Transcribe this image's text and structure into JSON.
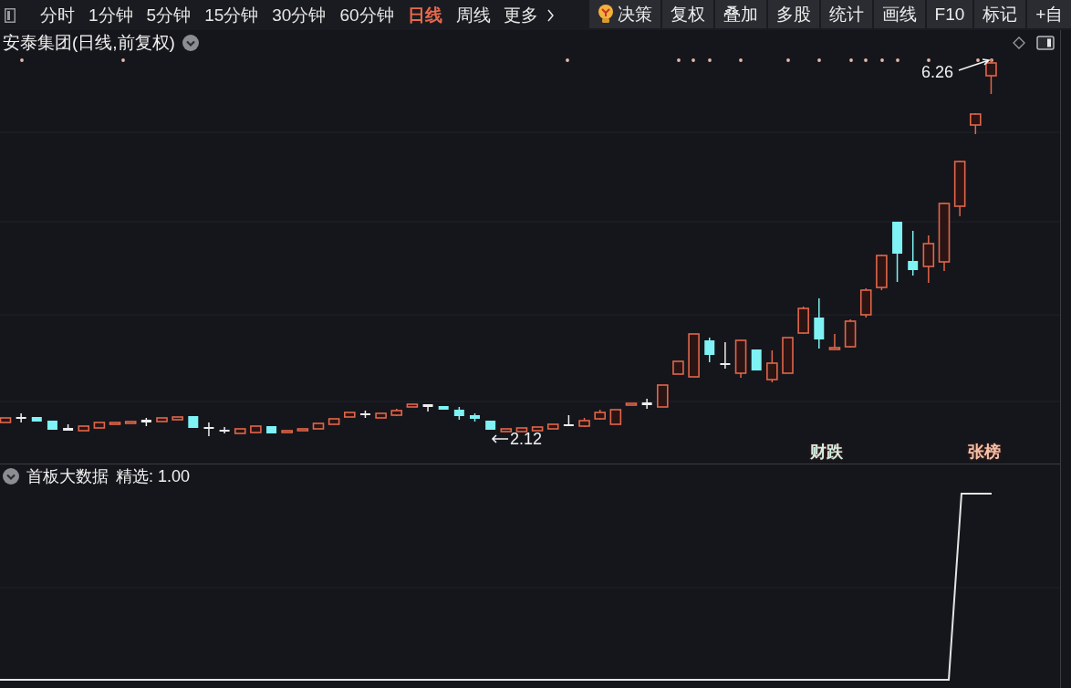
{
  "toolbar": {
    "periods": [
      {
        "label": "分时",
        "selected": false
      },
      {
        "label": "1分钟",
        "selected": false
      },
      {
        "label": "5分钟",
        "selected": false
      },
      {
        "label": "15分钟",
        "selected": false
      },
      {
        "label": "30分钟",
        "selected": false
      },
      {
        "label": "60分钟",
        "selected": false
      },
      {
        "label": "日线",
        "selected": true
      },
      {
        "label": "周线",
        "selected": false
      }
    ],
    "more": {
      "label": "更多"
    },
    "buttons": [
      {
        "label": "决策",
        "kind": "bulb"
      },
      {
        "label": "复权",
        "kind": "plain"
      },
      {
        "label": "叠加",
        "kind": "plain"
      },
      {
        "label": "多股",
        "kind": "plain"
      },
      {
        "label": "统计",
        "kind": "plain"
      },
      {
        "label": "画线",
        "kind": "plain"
      },
      {
        "label": "F10",
        "kind": "plain"
      },
      {
        "label": "标记",
        "kind": "plain"
      },
      {
        "label": "+自",
        "kind": "plain"
      }
    ]
  },
  "chart": {
    "title": "安泰集团(日线,前复权)",
    "max_label": "6.26",
    "min_label": "2.12",
    "signals": [
      {
        "text": "财跌",
        "color": "#d2efe4"
      },
      {
        "text": "张榜",
        "color": "#f2c2a8"
      }
    ]
  },
  "indicator": {
    "name": "首板大数据",
    "reading": "精选: 1.00"
  }
}
